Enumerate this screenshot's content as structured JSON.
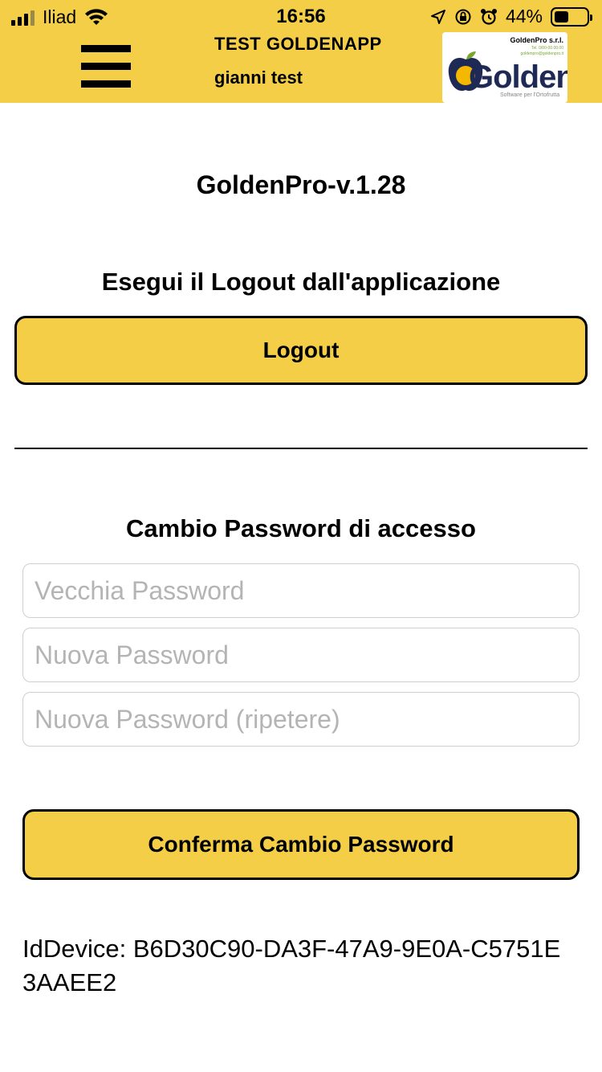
{
  "status_bar": {
    "carrier": "Iliad",
    "time": "16:56",
    "battery_percent": "44%",
    "battery_level": 0.44,
    "icons": [
      "signal-icon",
      "wifi-icon",
      "location-arrow-icon",
      "orientation-lock-icon",
      "alarm-icon",
      "battery-icon"
    ]
  },
  "header": {
    "title": "TEST GOLDENAPP",
    "user": "gianni test",
    "menu_icon": "hamburger-menu-icon",
    "background_color": "#F5CE47",
    "logo": {
      "company": "GoldenPro s.r.l.",
      "phone": "Tel. 0/00-00.00.00",
      "email": "goldenpro@goldenpro.it",
      "brand": "Golden",
      "tagline": "Software per l'Ortofrutta"
    }
  },
  "main": {
    "version": "GoldenPro-v.1.28",
    "logout_heading": "Esegui il Logout dall'applicazione",
    "logout_button": "Logout",
    "password_heading": "Cambio Password di accesso",
    "old_password": {
      "placeholder": "Vecchia Password",
      "value": ""
    },
    "new_password": {
      "placeholder": "Nuova Password",
      "value": ""
    },
    "repeat_password": {
      "placeholder": "Nuova Password (ripetere)",
      "value": ""
    },
    "confirm_button": "Conferma Cambio Password",
    "device_id": "IdDevice: B6D30C90-DA3F-47A9-9E0A-C5751E3AAEE2"
  },
  "colors": {
    "accent": "#F5CE47",
    "text": "#000000",
    "placeholder": "#B4B4B4",
    "logo_navy": "#1E2A55",
    "logo_green": "#7AA62F"
  }
}
